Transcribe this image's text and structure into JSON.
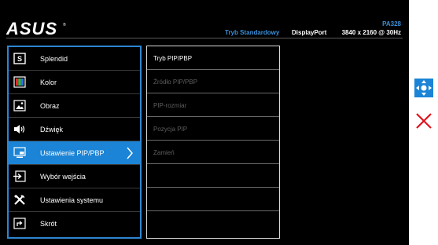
{
  "header": {
    "brand": "ASUS",
    "mode": "Tryb Standardowy",
    "model": "PA328",
    "input": "DisplayPort",
    "resolution": "3840 x 2160 @ 30Hz"
  },
  "main_menu": {
    "items": [
      {
        "label": "Splendid",
        "icon": "splendid-icon"
      },
      {
        "label": "Kolor",
        "icon": "color-icon"
      },
      {
        "label": "Obraz",
        "icon": "image-icon"
      },
      {
        "label": "Dźwięk",
        "icon": "speaker-icon"
      },
      {
        "label": "Ustawienie PIP/PBP",
        "icon": "pip-icon"
      },
      {
        "label": "Wybór wejścia",
        "icon": "input-select-icon"
      },
      {
        "label": "Ustawienia systemu",
        "icon": "tools-icon"
      },
      {
        "label": "Skrót",
        "icon": "shortcut-icon"
      }
    ],
    "active_index": 4
  },
  "sub_menu": {
    "items": [
      {
        "label": "Tryb PIP/PBP",
        "enabled": true
      },
      {
        "label": "Źródło PIP/PBP",
        "enabled": false
      },
      {
        "label": "PIP-rozmiar",
        "enabled": false
      },
      {
        "label": "Pozycja PIP",
        "enabled": false
      },
      {
        "label": "Zamień",
        "enabled": false
      },
      {
        "label": "",
        "enabled": false
      },
      {
        "label": "",
        "enabled": false
      },
      {
        "label": "",
        "enabled": false
      }
    ]
  },
  "controls": {
    "navigate_icon": "five-way-navigation-icon",
    "exit_icon": "close-icon"
  },
  "colors": {
    "accent": "#1b84d6",
    "header_text": "#3a8fd9",
    "disabled_text": "#5e5e5e",
    "exit_red": "#e0121b"
  }
}
